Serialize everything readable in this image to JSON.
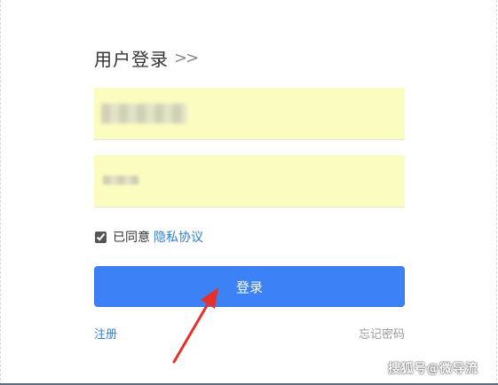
{
  "login": {
    "title": "用户登录",
    "title_chevrons": ">>",
    "username": {
      "value": "",
      "placeholder": ""
    },
    "password": {
      "value": "",
      "placeholder": ""
    },
    "agree": {
      "checked": true,
      "text": "已同意",
      "privacy_link": "隐私协议"
    },
    "login_button": "登录",
    "register_link": "注册",
    "forgot_link": "忘记密码"
  },
  "colors": {
    "primary_button": "#3c81f5",
    "link": "#2f7fd1",
    "field_background": "#fafcc0",
    "annotation_arrow": "#e5312a"
  },
  "icons": {
    "title_chevrons": "double-chevron-right-icon",
    "annotation": "red-arrow-icon"
  },
  "watermark": "搜狐号@微导流"
}
